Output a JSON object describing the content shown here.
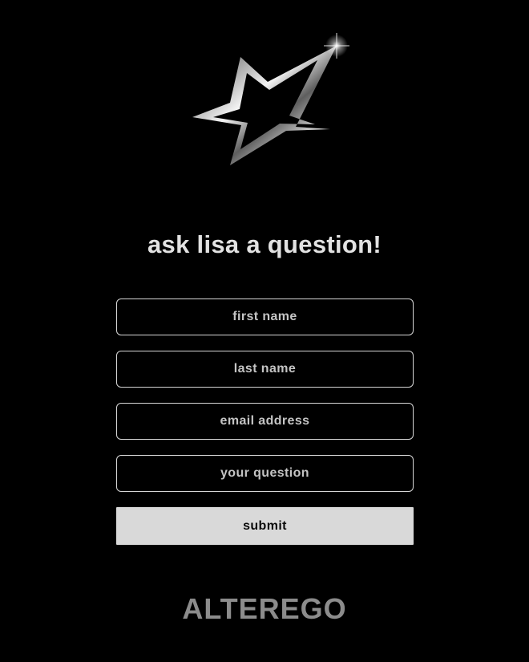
{
  "header": {
    "logo_icon": "chrome-star-icon",
    "title": "ask lisa a question!"
  },
  "form": {
    "fields": [
      {
        "name": "first-name",
        "placeholder": "first name",
        "value": ""
      },
      {
        "name": "last-name",
        "placeholder": "last name",
        "value": ""
      },
      {
        "name": "email-address",
        "placeholder": "email address",
        "value": ""
      },
      {
        "name": "your-question",
        "placeholder": "your question",
        "value": ""
      }
    ],
    "submit_label": "submit"
  },
  "footer": {
    "brand": "ALTEREGO"
  },
  "colors": {
    "background": "#000000",
    "field_border": "#d6d6d6",
    "submit_background": "#d9d9d9",
    "brand": "#8c8c8c"
  }
}
